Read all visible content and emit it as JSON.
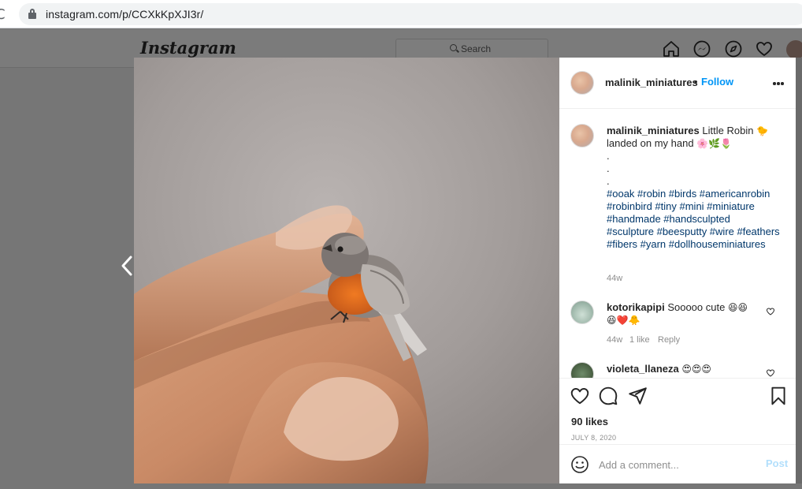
{
  "browser": {
    "url": "instagram.com/p/CCXkKpXJI3r/",
    "reload_glyph": "C"
  },
  "ig_header": {
    "logo": "Instagram",
    "search_placeholder": "Search",
    "icons": [
      "home-icon",
      "messenger-icon",
      "explore-icon",
      "activity-heart-icon",
      "profile-avatar"
    ]
  },
  "post": {
    "author": {
      "username": "malinik_miniatures",
      "separator": "•",
      "follow_label": "Follow"
    },
    "caption": {
      "username": "malinik_miniatures",
      "text_1": "Little Robin",
      "emoji_1": "🐤",
      "text_2": "landed on my hand",
      "emoji_2": "🌸🌿🌷",
      "dots": [
        ".",
        ".",
        "."
      ],
      "hashtags": "#ooak #robin #birds #americanrobin #robinbird #tiny #mini #miniature #handmade #handsculpted #sculpture #beesputty #wire #feathers #fibers #yarn #dollhouseminiatures",
      "time": "44w"
    },
    "comments": [
      {
        "username": "kotorikapipi",
        "text": "Sooooo cute",
        "emoji_inline": "😆😆",
        "emoji_line2": "😆❤️🐥",
        "time": "44w",
        "likes": "1 like",
        "reply": "Reply"
      },
      {
        "username": "violeta_llaneza",
        "emoji_inline": "😍😍😍"
      }
    ],
    "likes": "90 likes",
    "date": "JULY 8, 2020",
    "add_comment_placeholder": "Add a comment...",
    "post_label": "Post"
  },
  "colors": {
    "accent": "#0095f6",
    "hashtag": "#00376b",
    "muted": "#8e8e8e",
    "overlay": "#767676",
    "post_disabled": "#b2dffc"
  }
}
